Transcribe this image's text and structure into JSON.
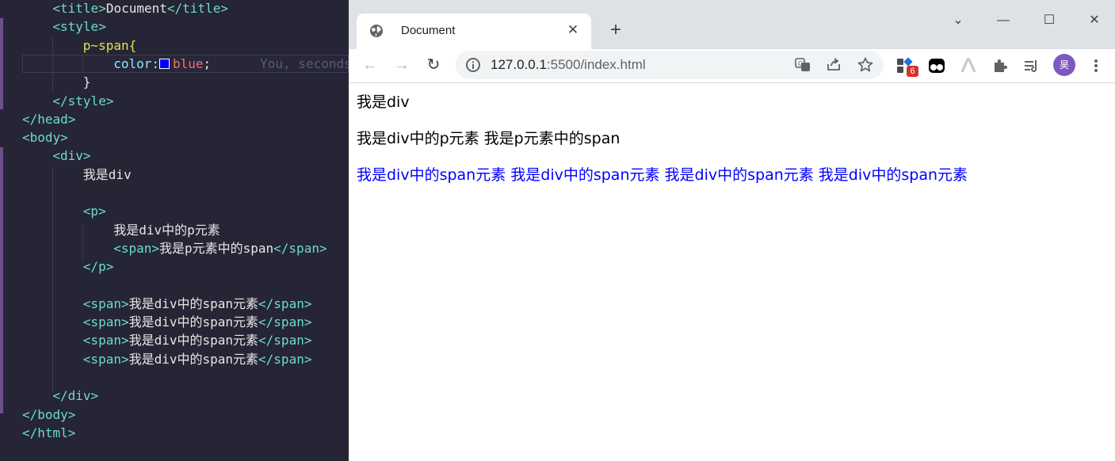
{
  "editor": {
    "lines": [
      {
        "type": "tag",
        "open": "<title>",
        "text": "Document",
        "close": "</title>",
        "indent": 4
      },
      {
        "type": "tag",
        "open": "<style>",
        "text": "",
        "close": "",
        "indent": 4
      },
      {
        "type": "selector",
        "text": "p~span{",
        "indent": 8
      },
      {
        "type": "prop",
        "name": "color:",
        "value": "blue",
        "end": ";",
        "ghost": "You, seconds",
        "indent": 12
      },
      {
        "type": "plain",
        "text": "}",
        "indent": 8
      },
      {
        "type": "tag",
        "open": "</style>",
        "text": "",
        "close": "",
        "indent": 4
      },
      {
        "type": "tag",
        "open": "</head>",
        "text": "",
        "close": "",
        "indent": 0
      },
      {
        "type": "tag",
        "open": "<body>",
        "text": "",
        "close": "",
        "indent": 0
      },
      {
        "type": "tag",
        "open": "<div>",
        "text": "",
        "close": "",
        "indent": 4
      },
      {
        "type": "plain",
        "text": "我是div",
        "indent": 8
      },
      {
        "type": "blank"
      },
      {
        "type": "tag",
        "open": "<p>",
        "text": "",
        "close": "",
        "indent": 8
      },
      {
        "type": "plain",
        "text": "我是div中的p元素",
        "indent": 12
      },
      {
        "type": "tag",
        "open": "<span>",
        "text": "我是p元素中的span",
        "close": "</span>",
        "indent": 12
      },
      {
        "type": "tag",
        "open": "</p>",
        "text": "",
        "close": "",
        "indent": 8
      },
      {
        "type": "blank"
      },
      {
        "type": "tag",
        "open": "<span>",
        "text": "我是div中的span元素",
        "close": "</span>",
        "indent": 8
      },
      {
        "type": "tag",
        "open": "<span>",
        "text": "我是div中的span元素",
        "close": "</span>",
        "indent": 8
      },
      {
        "type": "tag",
        "open": "<span>",
        "text": "我是div中的span元素",
        "close": "</span>",
        "indent": 8
      },
      {
        "type": "tag",
        "open": "<span>",
        "text": "我是div中的span元素",
        "close": "</span>",
        "indent": 8
      },
      {
        "type": "blank"
      },
      {
        "type": "tag",
        "open": "</div>",
        "text": "",
        "close": "",
        "indent": 4
      },
      {
        "type": "tag",
        "open": "</body>",
        "text": "",
        "close": "",
        "indent": 0
      },
      {
        "type": "tag",
        "open": "</html>",
        "text": "",
        "close": "",
        "indent": 0
      }
    ]
  },
  "browser": {
    "tab": {
      "title": "Document",
      "close": "✕",
      "icon": "globe-icon"
    },
    "new_tab": "+",
    "window": {
      "dropdown": "⌄",
      "minimize": "—",
      "maximize": "☐",
      "close": "✕"
    },
    "nav": {
      "back": "←",
      "forward": "→",
      "reload": "↻"
    },
    "url": {
      "host": "127.0.0.1",
      "rest": ":5500/index.html"
    },
    "extensions": {
      "badge_count": "6",
      "avatar_initial": "昊"
    },
    "page": {
      "line1": "我是div",
      "line2": "我是div中的p元素 我是p元素中的span",
      "line3": "我是div中的span元素 我是div中的span元素 我是div中的span元素 我是div中的span元素"
    }
  },
  "colors": {
    "editor_bg": "#262535",
    "tag": "#6bdcc7",
    "selector": "#dfe14d",
    "value": "#ff6b6b",
    "link_blue": "#0000ff"
  }
}
